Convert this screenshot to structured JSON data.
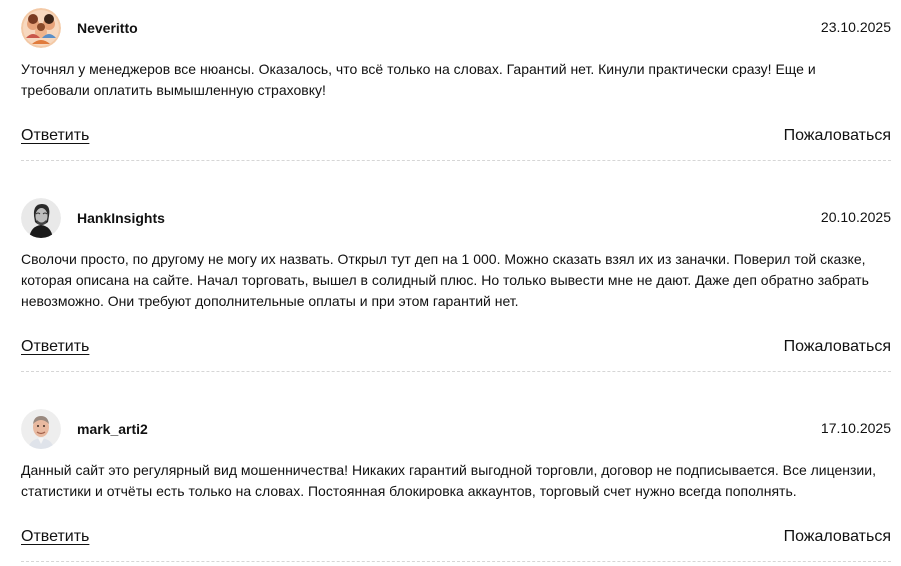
{
  "comments": [
    {
      "author": "Neveritto",
      "date": "23.10.2025",
      "text": "Уточнял у менеджеров все нюансы. Оказалось, что всё только на словах. Гарантий нет. Кинули практически сразу! Еще и требовали оплатить вымышленную страховку!",
      "reply_label": "Ответить",
      "report_label": "Пожаловаться",
      "avatar_icon": "cartoon-family-avatar"
    },
    {
      "author": "HankInsights",
      "date": "20.10.2025",
      "text": "Сволочи просто, по другому не могу их назвать. Открыл тут деп на 1 000. Можно сказать взял их из заначки. Поверил той сказке, которая описана на сайте. Начал торговать, вышел в солидный плюс. Но только вывести мне не дают. Даже деп обратно забрать невозможно. Они требуют дополнительные оплаты и при этом гарантий нет.",
      "reply_label": "Ответить",
      "report_label": "Пожаловаться",
      "avatar_icon": "bw-portrait-avatar"
    },
    {
      "author": "mark_arti2",
      "date": "17.10.2025",
      "text": "Данный сайт это регулярный вид мошенничества! Никаких гарантий выгодной торговли, договор не подписывается. Все лицензии, статистики и отчёты есть только на словах. Постоянная блокировка аккаунтов, торговый счет нужно всегда пополнять.",
      "reply_label": "Ответить",
      "report_label": "Пожаловаться",
      "avatar_icon": "man-portrait-avatar"
    }
  ]
}
